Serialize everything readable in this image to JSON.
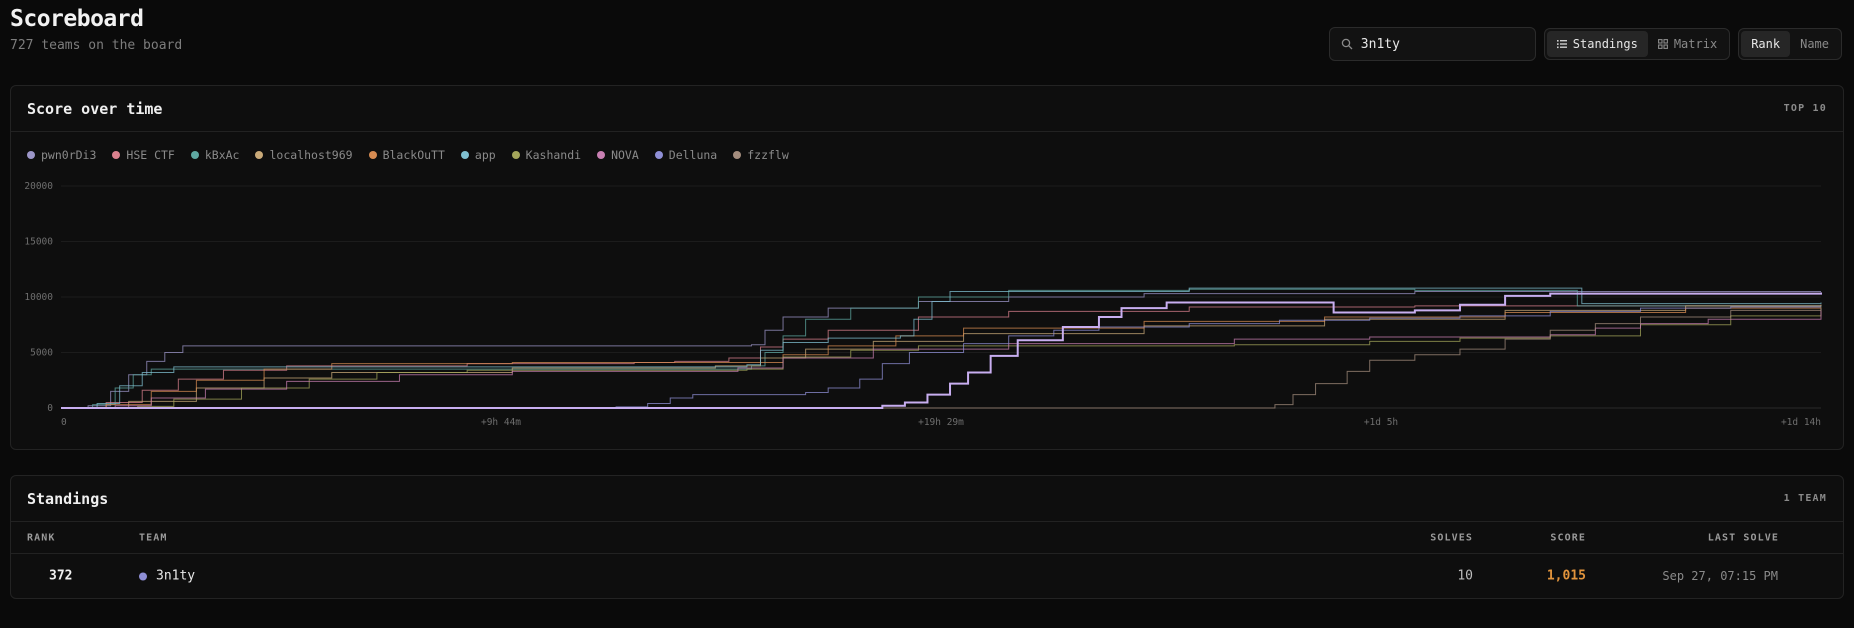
{
  "header": {
    "title": "Scoreboard",
    "subtitle": "727 teams on the board"
  },
  "search": {
    "value": "3n1ty",
    "icon": "search-icon"
  },
  "view_toggle": {
    "standings_label": "Standings",
    "matrix_label": "Matrix",
    "active": "Standings"
  },
  "sort_toggle": {
    "rank_label": "Rank",
    "name_label": "Name",
    "active": "Rank"
  },
  "chart_panel": {
    "title": "Score over time",
    "meta": "TOP 10"
  },
  "chart_data": {
    "type": "line",
    "ylim": [
      0,
      20000
    ],
    "y_ticks": [
      "0",
      "5000",
      "10000",
      "15000",
      "20000"
    ],
    "x_ticks": [
      "0",
      "+9h 44m",
      "+19h 29m",
      "+1d 5h",
      "+1d 14h"
    ],
    "x_unit": "hours",
    "xlim": [
      0,
      39
    ],
    "grid": true,
    "legend_position": "top-left",
    "series": [
      {
        "name": "pwn0rDi3",
        "color": "#9c96c8",
        "points": [
          [
            0,
            0
          ],
          [
            0.6,
            200
          ],
          [
            1.1,
            1500
          ],
          [
            1.5,
            3000
          ],
          [
            1.9,
            4200
          ],
          [
            2.3,
            5000
          ],
          [
            2.7,
            5600
          ],
          [
            15.3,
            5700
          ],
          [
            15.6,
            7000
          ],
          [
            16,
            8200
          ],
          [
            17,
            9000
          ],
          [
            19,
            9600
          ],
          [
            21,
            10000
          ],
          [
            24,
            10300
          ],
          [
            30,
            10500
          ],
          [
            39,
            10500
          ]
        ]
      },
      {
        "name": "HSE CTF",
        "color": "#d9808d",
        "points": [
          [
            0,
            0
          ],
          [
            1,
            500
          ],
          [
            1.8,
            1600
          ],
          [
            2.6,
            2600
          ],
          [
            3.6,
            3400
          ],
          [
            5,
            3800
          ],
          [
            9,
            4000
          ],
          [
            12.7,
            4100
          ],
          [
            13.6,
            4200
          ],
          [
            14.8,
            4500
          ],
          [
            15.5,
            5500
          ],
          [
            16,
            6200
          ],
          [
            17,
            7000
          ],
          [
            19,
            8200
          ],
          [
            21,
            8700
          ],
          [
            25,
            9100
          ],
          [
            30,
            9200
          ],
          [
            39,
            9300
          ]
        ]
      },
      {
        "name": "kBxAc",
        "color": "#5fa8a1",
        "points": [
          [
            0,
            0
          ],
          [
            0.7,
            300
          ],
          [
            1.2,
            1800
          ],
          [
            1.6,
            3000
          ],
          [
            2,
            3500
          ],
          [
            15.3,
            3800
          ],
          [
            15.6,
            5000
          ],
          [
            16,
            6500
          ],
          [
            16.5,
            8000
          ],
          [
            17.5,
            9000
          ],
          [
            19,
            10000
          ],
          [
            21,
            10600
          ],
          [
            25,
            10700
          ],
          [
            30,
            10600
          ],
          [
            33.5,
            10600
          ],
          [
            33.6,
            9200
          ],
          [
            39,
            9100
          ]
        ]
      },
      {
        "name": "localhost969",
        "color": "#c9a978",
        "points": [
          [
            0,
            0
          ],
          [
            1.5,
            600
          ],
          [
            3,
            1800
          ],
          [
            4.5,
            2700
          ],
          [
            6,
            3200
          ],
          [
            10,
            3600
          ],
          [
            14.5,
            3800
          ],
          [
            15.5,
            4500
          ],
          [
            16.5,
            5300
          ],
          [
            18,
            6000
          ],
          [
            20,
            6700
          ],
          [
            24,
            7400
          ],
          [
            28,
            8000
          ],
          [
            32,
            8800
          ],
          [
            36,
            9200
          ],
          [
            39,
            9300
          ]
        ]
      },
      {
        "name": "BlackOuTT",
        "color": "#d68b52",
        "points": [
          [
            0,
            0
          ],
          [
            1,
            300
          ],
          [
            2,
            1500
          ],
          [
            3,
            2500
          ],
          [
            4.5,
            3500
          ],
          [
            6,
            4000
          ],
          [
            10,
            4100
          ],
          [
            15,
            4100
          ],
          [
            16,
            4800
          ],
          [
            17,
            5600
          ],
          [
            18.5,
            6500
          ],
          [
            20,
            7200
          ],
          [
            24,
            7800
          ],
          [
            28,
            8200
          ],
          [
            32,
            8600
          ],
          [
            36,
            9000
          ],
          [
            39,
            9100
          ]
        ]
      },
      {
        "name": "app",
        "color": "#7fbfd0",
        "points": [
          [
            0,
            0
          ],
          [
            0.8,
            400
          ],
          [
            1.3,
            2000
          ],
          [
            1.8,
            3200
          ],
          [
            2.5,
            3700
          ],
          [
            15.2,
            3900
          ],
          [
            15.5,
            5200
          ],
          [
            16,
            5900
          ],
          [
            17,
            6300
          ],
          [
            18.6,
            6500
          ],
          [
            18.9,
            8000
          ],
          [
            19.3,
            9600
          ],
          [
            19.7,
            10500
          ],
          [
            25,
            10800
          ],
          [
            33.6,
            10800
          ],
          [
            33.7,
            9400
          ],
          [
            39,
            9500
          ]
        ]
      },
      {
        "name": "Kashandi",
        "color": "#a3a55a",
        "points": [
          [
            0,
            0
          ],
          [
            1.7,
            150
          ],
          [
            2.5,
            800
          ],
          [
            4,
            1800
          ],
          [
            5.5,
            2600
          ],
          [
            7,
            3200
          ],
          [
            9,
            3400
          ],
          [
            15.2,
            3500
          ],
          [
            16,
            4600
          ],
          [
            17.5,
            5200
          ],
          [
            19,
            5600
          ],
          [
            23,
            5600
          ],
          [
            26,
            5700
          ],
          [
            29,
            6000
          ],
          [
            31,
            6300
          ],
          [
            33,
            6500
          ],
          [
            35,
            7500
          ],
          [
            37,
            8300
          ],
          [
            39,
            9000
          ]
        ]
      },
      {
        "name": "NOVA",
        "color": "#c87fb2",
        "points": [
          [
            0,
            0
          ],
          [
            1.2,
            200
          ],
          [
            2,
            900
          ],
          [
            3.2,
            1700
          ],
          [
            5,
            2400
          ],
          [
            7.5,
            3000
          ],
          [
            10,
            3300
          ],
          [
            15,
            3600
          ],
          [
            16,
            4500
          ],
          [
            18,
            5300
          ],
          [
            21,
            5800
          ],
          [
            26,
            6200
          ],
          [
            29,
            6400
          ],
          [
            33,
            6600
          ],
          [
            34,
            7200
          ],
          [
            35,
            7600
          ],
          [
            36.5,
            8000
          ],
          [
            39,
            8900
          ]
        ]
      },
      {
        "name": "Delluna",
        "color": "#8f8fd6",
        "points": [
          [
            0,
            0
          ],
          [
            11.5,
            0
          ],
          [
            12.3,
            100
          ],
          [
            13,
            400
          ],
          [
            13.5,
            900
          ],
          [
            14,
            1200
          ],
          [
            16.5,
            1400
          ],
          [
            17,
            1800
          ],
          [
            17.7,
            2600
          ],
          [
            18.2,
            4000
          ],
          [
            18.8,
            5000
          ],
          [
            20,
            5800
          ],
          [
            21,
            6500
          ],
          [
            22,
            7000
          ],
          [
            23,
            7300
          ],
          [
            25,
            7600
          ],
          [
            27,
            7900
          ],
          [
            29,
            8100
          ],
          [
            31,
            8300
          ],
          [
            33,
            8700
          ],
          [
            35,
            9000
          ],
          [
            37,
            9100
          ],
          [
            39,
            9100
          ]
        ]
      },
      {
        "name": "fzzflw",
        "color": "#a48d7e",
        "points": [
          [
            0,
            0
          ],
          [
            26.5,
            0
          ],
          [
            26.9,
            300
          ],
          [
            27.3,
            1200
          ],
          [
            27.8,
            2200
          ],
          [
            28.5,
            3300
          ],
          [
            29,
            4300
          ],
          [
            30,
            4800
          ],
          [
            31,
            5300
          ],
          [
            32,
            6200
          ],
          [
            33,
            7000
          ],
          [
            34,
            7600
          ],
          [
            35,
            8200
          ],
          [
            37,
            8800
          ],
          [
            39,
            9000
          ]
        ]
      },
      {
        "name": "3n1ty",
        "color": "#c8aef0",
        "highlight": true,
        "points": [
          [
            0,
            0
          ],
          [
            17.7,
            0
          ],
          [
            18.2,
            200
          ],
          [
            18.7,
            500
          ],
          [
            19.2,
            1200
          ],
          [
            19.7,
            2200
          ],
          [
            20.1,
            3200
          ],
          [
            20.6,
            4700
          ],
          [
            21.2,
            6100
          ],
          [
            22.2,
            7300
          ],
          [
            23,
            8200
          ],
          [
            23.5,
            9000
          ],
          [
            24.5,
            9500
          ],
          [
            28,
            9500
          ],
          [
            28.2,
            8600
          ],
          [
            30,
            8800
          ],
          [
            31,
            9300
          ],
          [
            32,
            10100
          ],
          [
            33,
            10300
          ],
          [
            36,
            10300
          ],
          [
            39,
            10400
          ]
        ]
      }
    ]
  },
  "standings_panel": {
    "title": "Standings",
    "meta": "1 TEAM"
  },
  "table": {
    "headers": {
      "rank": "RANK",
      "team": "TEAM",
      "solves": "SOLVES",
      "score": "SCORE",
      "last_solve": "LAST SOLVE"
    },
    "rows": [
      {
        "rank": "372",
        "team": "3n1ty",
        "team_color": "#8f8fd6",
        "solves": "10",
        "score": "1,015",
        "last_solve": "Sep 27, 07:15 PM"
      }
    ]
  }
}
